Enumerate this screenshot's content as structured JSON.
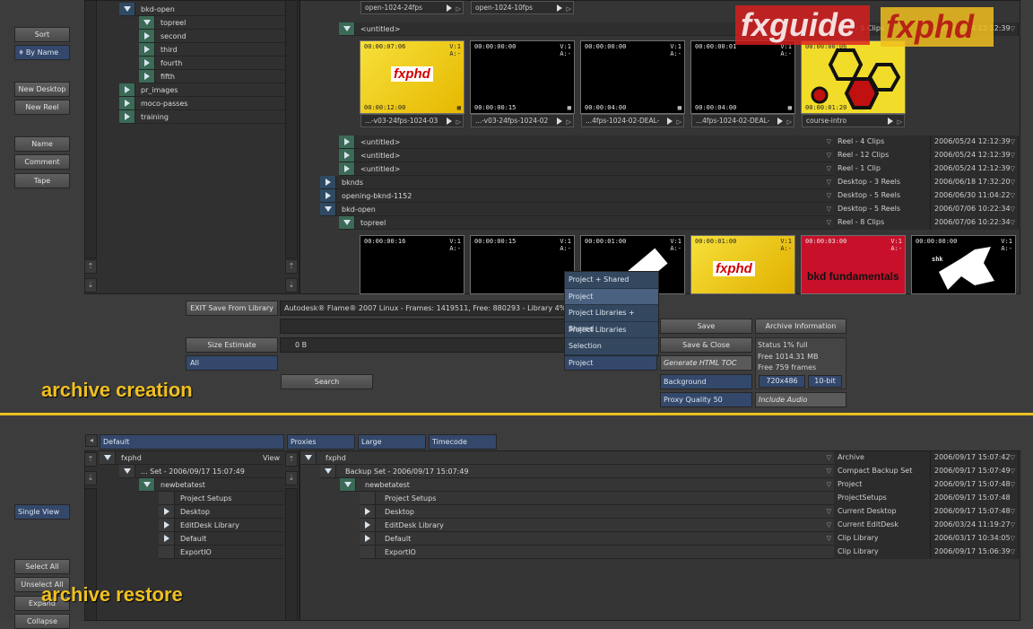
{
  "left_buttons_top": {
    "sort": "Sort",
    "by_name": "By Name",
    "new_desktop": "New Desktop",
    "new_reel": "New Reel",
    "name": "Name",
    "comment": "Comment",
    "tape": "Tape"
  },
  "top_tree": {
    "bkd_open": "bkd-open",
    "items": [
      "topreel",
      "second",
      "third",
      "fourth",
      "fifth"
    ],
    "pr_images": "pr_images",
    "moco_passes": "moco-passes",
    "training": "training"
  },
  "top_captions_row0": [
    "open-1024-24fps",
    "open-1024-10fps"
  ],
  "untitled_top": "<untitled>",
  "reel_header_right": "Reel - 5 Clips",
  "reel_header_date": "2006/05/24 12:12:39",
  "clips_row1": [
    {
      "tc_in": "00:00:07:06",
      "tc_out": "00:00:12:00",
      "label": "...-v03-24fps-1024-03",
      "logo": "fxphd"
    },
    {
      "tc_in": "00:00:00:00",
      "tc_out": "00:00:00:15",
      "label": "...-v03-24fps-1024-02"
    },
    {
      "tc_in": "00:00:00:00",
      "tc_out": "00:00:04:00",
      "label": "...4fps-1024-02-DEAL-"
    },
    {
      "tc_in": "00:00:00:01",
      "tc_out": "00:00:04:00",
      "label": "...4fps-1024-02-DEAL-"
    },
    {
      "tc_in": "00:00:00:06",
      "tc_out": "00:00:01:20",
      "label": "course-intro"
    }
  ],
  "track_label": "V:1",
  "audio_label": "A:-",
  "list_rows": [
    {
      "name": "<untitled>",
      "type": "Reel - 4 Clips",
      "date": "2006/05/24 12:12:39"
    },
    {
      "name": "<untitled>",
      "type": "Reel - 12 Clips",
      "date": "2006/05/24 12:12:39"
    },
    {
      "name": "<untitled>",
      "type": "Reel - 1 Clip",
      "date": "2006/05/24 12:12:39"
    },
    {
      "name": "bknds",
      "type": "Desktop - 3 Reels",
      "date": "2006/06/18 17:32:20"
    },
    {
      "name": "opening-bknd-1152",
      "type": "Desktop - 5 Reels",
      "date": "2006/06/30 11:04:22"
    },
    {
      "name": "bkd-open",
      "type": "Desktop - 5 Reels",
      "date": "2006/07/06 10:22:34"
    },
    {
      "name": "topreel",
      "type": "Reel - 8 Clips",
      "date": "2006/07/06 10:22:34"
    }
  ],
  "clips_row2": [
    {
      "tc_in": "00:00:00:16"
    },
    {
      "tc_in": "00:00:00:15"
    },
    {
      "tc_in": "00:00:01:00"
    },
    {
      "tc_in": "00:00:01:00",
      "logo": "fxphd"
    },
    {
      "tc_in": "00:00:03:00",
      "logo": "bkd fundamentals"
    },
    {
      "tc_in": "00:00:00:00",
      "logo": "shk"
    }
  ],
  "exit_button": "EXIT Save From Library",
  "status_line": "Autodesk® Flame® 2007 Linux - Frames: 1419511, Free: 880293 - Library 4% free",
  "size_estimate": "Size Estimate",
  "size_value": "0  B",
  "all_label": "All",
  "search_label": "Search",
  "dropdown": {
    "items": [
      "Project + Shared",
      "Project",
      "Project Libraries + Shared",
      "Project Libraries",
      "Selection"
    ],
    "highlighted": "Project",
    "selected": "Project"
  },
  "save": "Save",
  "save_close": "Save & Close",
  "archive_info": "Archive Information",
  "gen_html": "Generate HTML TOC",
  "status_full": "Status 1% full",
  "free_mb": "Free 1014.31 MB",
  "free_frames": "Free 759 frames",
  "resolution": "720x486",
  "bitdepth": "10-bit",
  "background": "Background",
  "proxy_quality": "Proxy Quality 50",
  "include_audio": "Include Audio",
  "caption_top": "archive creation",
  "caption_bottom": "archive restore",
  "logo_fxguide": "fxguide",
  "logo_fxphd": "fxphd",
  "bottom_tabs": {
    "default": "Default",
    "proxies": "Proxies",
    "large": "Large",
    "timecode": "Timecode"
  },
  "bottom_left_tree": {
    "root": "fxphd",
    "view": "View",
    "set": "... Set - 2006/09/17 15:07:49",
    "project": "newbetatest",
    "children": [
      "Project Setups",
      "Desktop",
      "EditDesk Library",
      "Default",
      "ExportIO"
    ]
  },
  "bottom_right_rows": [
    {
      "name": "fxphd",
      "type": "Archive",
      "date": "2006/09/17 15:07:42"
    },
    {
      "name": "Backup Set - 2006/09/17 15:07:49",
      "type": "Compact Backup Set",
      "date": "2006/09/17 15:07:49"
    },
    {
      "name": "newbetatest",
      "type": "Project",
      "date": "2006/09/17 15:07:48"
    },
    {
      "name": "Project Setups",
      "type": "ProjectSetups",
      "date": "2006/09/17 15:07:48"
    },
    {
      "name": "Desktop",
      "type": "Current Desktop",
      "date": "2006/09/17 15:07:48"
    },
    {
      "name": "EditDesk Library",
      "type": "Current EditDesk",
      "date": "2006/03/24 11:19:27"
    },
    {
      "name": "Default",
      "type": "Clip Library",
      "date": "2006/03/17 10:34:05"
    },
    {
      "name": "ExportIO",
      "type": "Clip Library",
      "date": "2006/09/17 15:06:39"
    }
  ],
  "left_buttons_bottom": {
    "single_view": "Single View",
    "select_all": "Select All",
    "unselect_all": "Unselect All",
    "expand": "Expand",
    "collapse": "Collapse"
  }
}
